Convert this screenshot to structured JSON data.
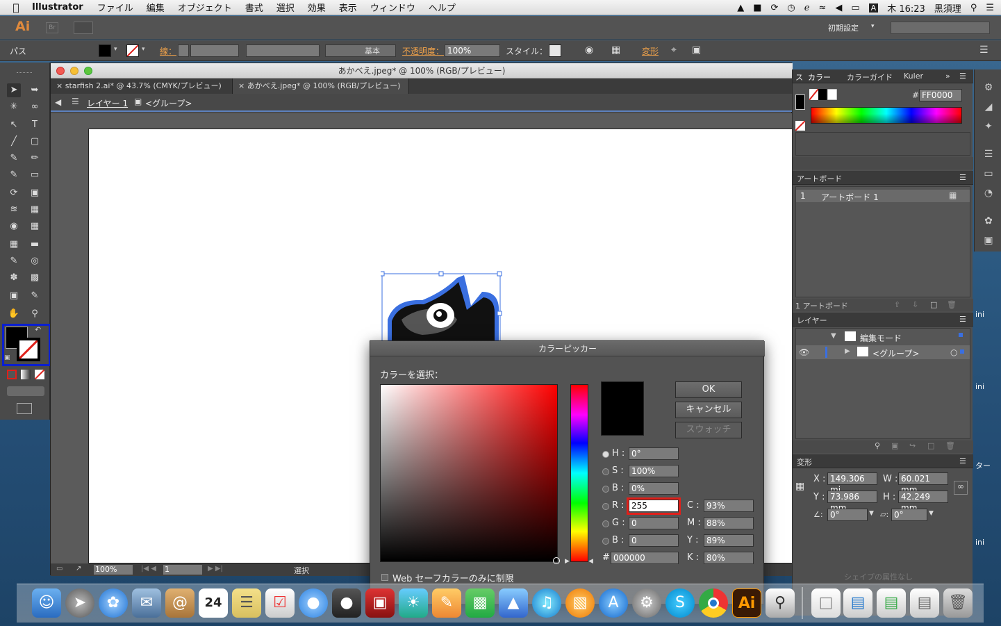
{
  "menubar": {
    "app": "Illustrator",
    "items": [
      "ファイル",
      "編集",
      "オブジェクト",
      "書式",
      "選択",
      "効果",
      "表示",
      "ウィンドウ",
      "ヘルプ"
    ],
    "clock": "木 16:23",
    "user": "黒須理"
  },
  "appbar": {
    "logo": "Ai",
    "br": "Br",
    "workspace": "初期設定"
  },
  "control": {
    "selection_label": "パス",
    "stroke_label": "線：",
    "stroke_profile": "基本",
    "opacity_label": "不透明度：",
    "opacity_value": "100%",
    "style_label": "スタイル：",
    "transform_label": "変形"
  },
  "document": {
    "title": "あかべえ.jpeg* @ 100% (RGB/プレビュー)",
    "tabs": [
      {
        "label": "starfish 2.ai* @ 43.7% (CMYK/プレビュー)"
      },
      {
        "label": "あかべえ.jpeg* @ 100% (RGB/プレビュー)"
      }
    ],
    "breadcrumb_layer": "レイヤー 1",
    "breadcrumb_group": "<グループ>",
    "zoom": "100%",
    "page": "1",
    "status": "選択"
  },
  "colorpanel": {
    "tabs": [
      "カラー",
      "カラーガイド",
      "Kuler"
    ],
    "hex_label": "#",
    "hex_value": "FF0000"
  },
  "artboards": {
    "title": "アートボード",
    "row_index": "1",
    "row_name": "アートボード 1",
    "footer": "1 アートボード"
  },
  "layers": {
    "title": "レイヤー",
    "row1": "編集モード",
    "row2": "<グループ>"
  },
  "transform": {
    "title": "変形",
    "x_label": "X :",
    "x": "149.306 mi",
    "y_label": "Y :",
    "y": "73.986 mm",
    "w_label": "W :",
    "w": "60.021 mm",
    "h_label": "H :",
    "h": "42.249 mm",
    "angle": "0°",
    "shear": "0°",
    "no_attr": "シェイプの属性なし"
  },
  "picker": {
    "title": "カラーピッカー",
    "select_label": "カラーを選択：",
    "ok": "OK",
    "cancel": "キャンセル",
    "swatch": "スウォッチ",
    "h_label": "H :",
    "h": "0°",
    "s_label": "S :",
    "s": "100%",
    "b_label": "B :",
    "b": "0%",
    "r_label": "R :",
    "r": "255",
    "g_label": "G :",
    "g": "0",
    "bb_label": "B :",
    "bb": "0",
    "hash": "#",
    "hex": "000000",
    "c_label": "C :",
    "c": "93%",
    "m_label": "M :",
    "m": "88%",
    "yy_label": "Y :",
    "yy": "89%",
    "k_label": "K :",
    "k": "80%",
    "web_only": "Web セーフカラーのみに制限"
  },
  "desktop": {
    "label1": "ini",
    "label2": "ini",
    "label3": "ター",
    "label4": "ini"
  },
  "dock": {
    "calendar_day": "24",
    "ai_label": "Ai"
  },
  "colors": {
    "accent_orange": "#f0a24a",
    "selection_blue": "#3a6fe0",
    "highlight_red": "#e0201a",
    "focus_blue": "#0a1fd0"
  }
}
